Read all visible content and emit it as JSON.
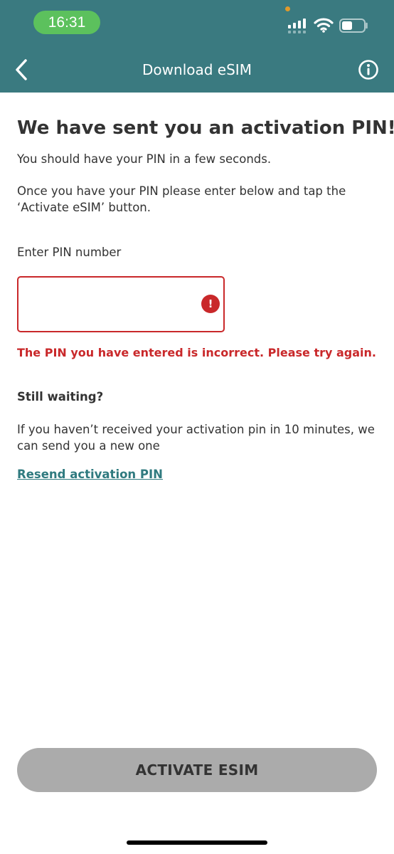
{
  "status_bar": {
    "time": "16:31",
    "time_pill_color": "#5cc15d",
    "icons": [
      "signal-icon",
      "wifi-icon",
      "battery-icon"
    ]
  },
  "header": {
    "title": "Download eSIM",
    "background_color": "#3a7a80",
    "back_icon": "chevron-left-icon",
    "info_icon": "info-icon"
  },
  "main": {
    "title": "We have sent you an activation PIN!",
    "intro": "You should have your PIN in a few seconds.",
    "instructions": "Once you have your PIN please enter below and tap the ‘Activate eSIM’ button.",
    "pin_label": "Enter PIN number",
    "pin_value": "",
    "error_icon_glyph": "!",
    "error_message": "The PIN you have entered is incorrect. Please try again.",
    "error_color": "#c9282a",
    "waiting_heading": "Still waiting?",
    "waiting_text": "If you haven’t received your activation pin in 10 minutes, we can send you a new one",
    "resend_link": "Resend activation PIN",
    "link_color": "#2f7a7f"
  },
  "footer": {
    "activate_button": "ACTIVATE ESIM",
    "activate_button_state": "disabled",
    "activate_button_color": "#ababab"
  }
}
